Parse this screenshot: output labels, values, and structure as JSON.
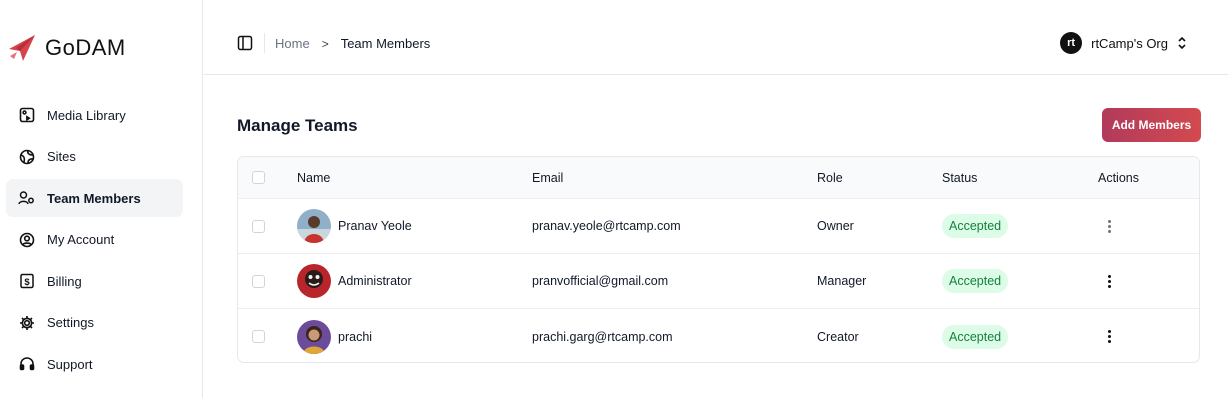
{
  "brand": {
    "name": "GoDAM",
    "accent": "#d8434a"
  },
  "sidebar": {
    "items": [
      {
        "label": "Media Library",
        "icon": "media-library-icon"
      },
      {
        "label": "Sites",
        "icon": "globe-icon"
      },
      {
        "label": "Team Members",
        "icon": "users-icon",
        "active": true
      },
      {
        "label": "My Account",
        "icon": "user-circle-icon"
      },
      {
        "label": "Billing",
        "icon": "dollar-icon"
      },
      {
        "label": "Settings",
        "icon": "gear-icon"
      },
      {
        "label": "Support",
        "icon": "headset-icon"
      }
    ]
  },
  "topbar": {
    "breadcrumb": {
      "home": "Home",
      "separator": ">",
      "current": "Team Members"
    },
    "org": {
      "avatar_text": "rt",
      "name": "rtCamp's Org"
    }
  },
  "main": {
    "title": "Manage Teams",
    "add_button": "Add Members",
    "table": {
      "headers": {
        "name": "Name",
        "email": "Email",
        "role": "Role",
        "status": "Status",
        "actions": "Actions"
      },
      "rows": [
        {
          "name": "Pranav Yeole",
          "email": "pranav.yeole@rtcamp.com",
          "role": "Owner",
          "status": "Accepted"
        },
        {
          "name": "Administrator",
          "email": "pranvofficial@gmail.com",
          "role": "Manager",
          "status": "Accepted"
        },
        {
          "name": "prachi",
          "email": "prachi.garg@rtcamp.com",
          "role": "Creator",
          "status": "Accepted"
        }
      ]
    }
  },
  "colors": {
    "badge_bg": "#dcfce7",
    "badge_text": "#15803d",
    "button_from": "#b13a5b",
    "button_to": "#d34a4f"
  }
}
